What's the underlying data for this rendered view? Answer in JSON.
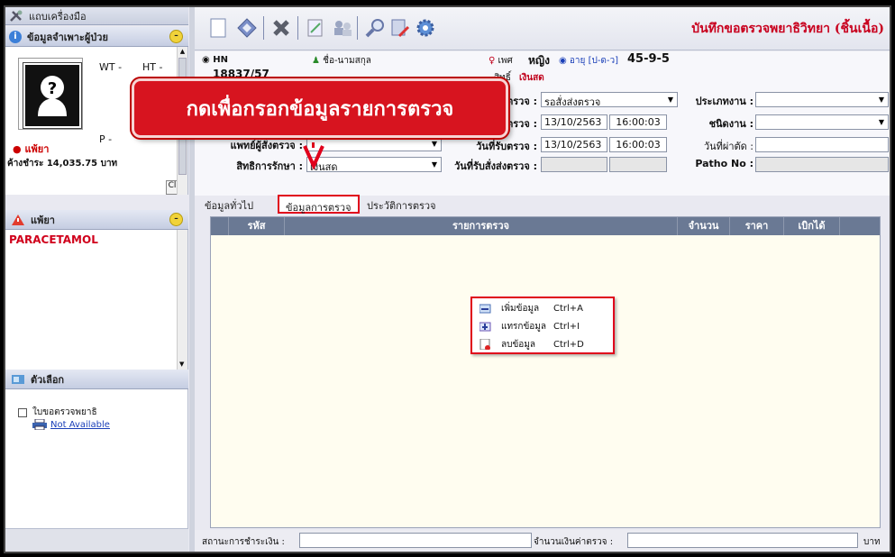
{
  "sidebar": {
    "toolbar_title": "แถบเครื่องมือ",
    "patient_section": "ข้อมูลจำเพาะผู้ป่วย",
    "wt_label": "WT -",
    "ht_label": "HT -",
    "p_label": "P -",
    "allergy_tag": "แพ้ยา",
    "outstanding_balance": "ค้างชำระ 14,035.75 บาท",
    "clear_button": "Cl",
    "drug_allergy_section": "แพ้ยา",
    "drug_allergy_items": [
      "PARACETAMOL"
    ],
    "options_section": "ตัวเลือก",
    "option_checkbox_label": "ใบขอตรวจพยาธิ",
    "print_link": "Not Available"
  },
  "window_title": "บันทึกขอตรวจพยาธิวิทยา (ชิ้นเนื้อ)",
  "header": {
    "hn_label": "HN",
    "hn_value": "18837/57",
    "name_label": "ชื่อ-นามสกุล",
    "sex_label": "เพศ",
    "sex_value": "หญิง",
    "age_label": "อายุ [ป-ด-ว]",
    "age_value": "45-9-5",
    "right_label": "สิทธิ์",
    "right_value": "เงินสด"
  },
  "form": {
    "status_label": "สถานะตรวจ :",
    "status_value": "รอสั่งส่งตรวจ",
    "order_date_label": "วันที่สั่งตรวจ :",
    "order_date": "13/10/2563",
    "order_time": "16:00:03",
    "receive_date_label": "วันที่รับตรวจ :",
    "receive_date": "13/10/2563",
    "receive_time": "16:00:03",
    "doctor_label": "แพทย์ผู้สั่งตรวจ :",
    "right_treat_label": "สิทธิการรักษา :",
    "right_treat_value": "เงินสด",
    "send_date_label": "วันที่รับสั่งส่งตรวจ :",
    "work_type_label": "ประเภทงาน :",
    "work_kind_label": "ชนิดงาน :",
    "surgery_date_label": "วันที่ผ่าตัด :",
    "patho_no_label": "Patho No :"
  },
  "tabs": [
    "ข้อมูลทั่วไป",
    "ข้อมูลการตรวจ",
    "ประวัติการตรวจ"
  ],
  "table": {
    "columns": [
      "รหัส",
      "รายการตรวจ",
      "จำนวน",
      "ราคา",
      "เบิกได้"
    ]
  },
  "context_menu": [
    {
      "label": "เพิ่มข้อมูล",
      "shortcut": "Ctrl+A",
      "icon": "add-row-icon"
    },
    {
      "label": "แทรกข้อมูล",
      "shortcut": "Ctrl+I",
      "icon": "insert-row-icon"
    },
    {
      "label": "ลบข้อมูล",
      "shortcut": "Ctrl+D",
      "icon": "delete-row-icon"
    }
  ],
  "footer": {
    "payment_status_label": "สถานะการชำระเงิน :",
    "amount_label": "จำนวนเงินค่าตรวจ :",
    "currency": "บาท"
  },
  "callout": "กดเพื่อกรอกข้อมูลรายการตรวจ",
  "colors": {
    "title": "#c8001e",
    "callout_bg": "#d7141f",
    "highlight": "#e0001b",
    "table_header": "#6a7994"
  }
}
